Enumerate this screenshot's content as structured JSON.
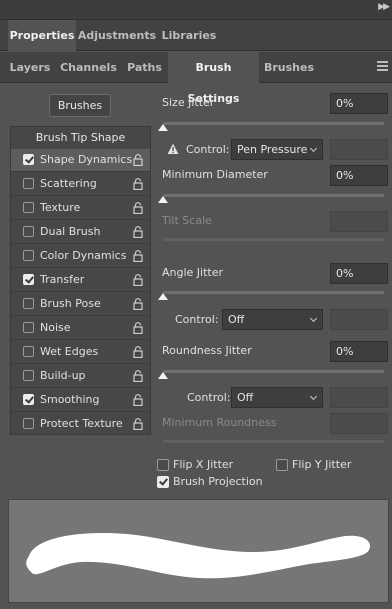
{
  "tabs_row1": [
    {
      "label": "Properties",
      "active": true
    },
    {
      "label": "Adjustments",
      "active": false
    },
    {
      "label": "Libraries",
      "active": false
    }
  ],
  "tabs_row2": [
    {
      "label": "Layers",
      "active": false
    },
    {
      "label": "Channels",
      "active": false
    },
    {
      "label": "Paths",
      "active": false
    },
    {
      "label": "Brush Settings",
      "active": true
    },
    {
      "label": "Brushes",
      "active": false
    }
  ],
  "brushes_button": "Brushes",
  "options_header": "Brush Tip Shape",
  "options": [
    {
      "label": "Shape Dynamics",
      "checked": true,
      "selected": true
    },
    {
      "label": "Scattering",
      "checked": false,
      "selected": false
    },
    {
      "label": "Texture",
      "checked": false,
      "selected": false
    },
    {
      "label": "Dual Brush",
      "checked": false,
      "selected": false
    },
    {
      "label": "Color Dynamics",
      "checked": false,
      "selected": false
    },
    {
      "label": "Transfer",
      "checked": true,
      "selected": false
    },
    {
      "label": "Brush Pose",
      "checked": false,
      "selected": false
    },
    {
      "label": "Noise",
      "checked": false,
      "selected": false
    },
    {
      "label": "Wet Edges",
      "checked": false,
      "selected": false
    },
    {
      "label": "Build-up",
      "checked": false,
      "selected": false
    },
    {
      "label": "Smoothing",
      "checked": true,
      "selected": false
    },
    {
      "label": "Protect Texture",
      "checked": false,
      "selected": false
    }
  ],
  "settings": {
    "size_jitter": {
      "label": "Size Jitter",
      "value": "0%"
    },
    "size_control": {
      "label": "Control:",
      "value": "Pen Pressure"
    },
    "min_diameter": {
      "label": "Minimum Diameter",
      "value": "0%"
    },
    "tilt_scale": {
      "label": "Tilt Scale"
    },
    "angle_jitter": {
      "label": "Angle Jitter",
      "value": "0%"
    },
    "angle_control": {
      "label": "Control:",
      "value": "Off"
    },
    "roundness_jitter": {
      "label": "Roundness Jitter",
      "value": "0%"
    },
    "roundness_control": {
      "label": "Control:",
      "value": "Off"
    },
    "min_roundness": {
      "label": "Minimum Roundness"
    }
  },
  "flip_x": {
    "label": "Flip X Jitter",
    "checked": false
  },
  "flip_y": {
    "label": "Flip Y Jitter",
    "checked": false
  },
  "brush_projection": {
    "label": "Brush Projection",
    "checked": true
  },
  "colors": {
    "panel": "#535353",
    "tab_bar": "#424242",
    "field": "#3e3e3e",
    "preview_bg": "#767676",
    "stroke": "#ffffff"
  }
}
